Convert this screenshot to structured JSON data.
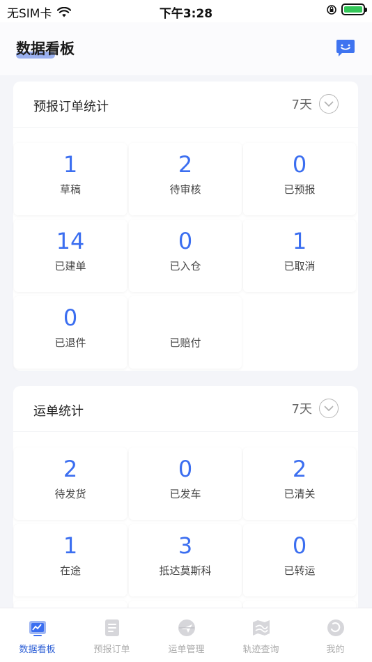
{
  "status_bar": {
    "carrier": "无SIM卡",
    "time": "下午3:28"
  },
  "header": {
    "title": "数据看板"
  },
  "forecast_card": {
    "title": "预报订单统计",
    "period": "7天",
    "items": [
      {
        "value": "1",
        "label": "草稿"
      },
      {
        "value": "2",
        "label": "待审核"
      },
      {
        "value": "0",
        "label": "已预报"
      },
      {
        "value": "14",
        "label": "已建单"
      },
      {
        "value": "0",
        "label": "已入仓"
      },
      {
        "value": "1",
        "label": "已取消"
      },
      {
        "value": "0",
        "label": "已退件"
      },
      {
        "value": "",
        "label": "已赔付"
      }
    ]
  },
  "waybill_card": {
    "title": "运单统计",
    "period": "7天",
    "items": [
      {
        "value": "2",
        "label": "待发货"
      },
      {
        "value": "0",
        "label": "已发车"
      },
      {
        "value": "2",
        "label": "已清关"
      },
      {
        "value": "1",
        "label": "在途"
      },
      {
        "value": "3",
        "label": "抵达莫斯科"
      },
      {
        "value": "0",
        "label": "已转运"
      }
    ]
  },
  "tabbar": {
    "items": [
      {
        "label": "数据看板",
        "icon": "dashboard-icon",
        "active": true
      },
      {
        "label": "预报订单",
        "icon": "order-icon",
        "active": false
      },
      {
        "label": "运单管理",
        "icon": "waybill-icon",
        "active": false
      },
      {
        "label": "轨迹查询",
        "icon": "track-icon",
        "active": false
      },
      {
        "label": "我的",
        "icon": "profile-icon",
        "active": false
      }
    ]
  },
  "colors": {
    "accent": "#3b6ef0",
    "tab_active": "#2f61d6",
    "tab_inactive": "#aaaaaa"
  }
}
